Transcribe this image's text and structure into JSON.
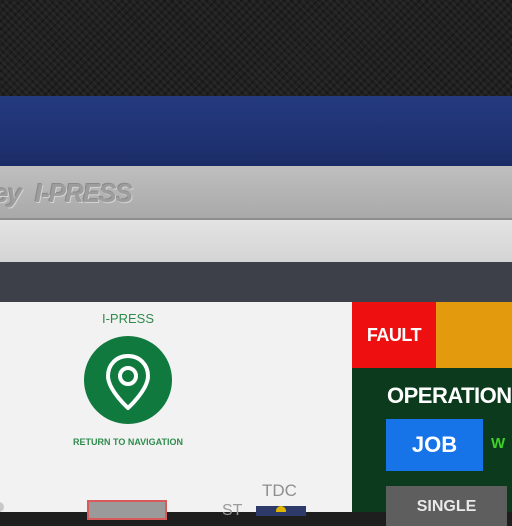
{
  "header": {
    "title_partial": "ey",
    "title": "I-PRESS"
  },
  "navigation": {
    "label": "I-PRESS",
    "return_label": "RETURN TO NAVIGATION",
    "icon": "map-pin-icon"
  },
  "status": {
    "fault_label": "FAULT",
    "warning_color": "#e39a0c",
    "fault_color": "#ee1010"
  },
  "operation": {
    "title": "OPERATION",
    "job_label": "JOB",
    "job_side_label": "W",
    "single_label": "SINGLE"
  },
  "indicators": {
    "st_label": "ST",
    "tdc_label": "TDC"
  }
}
